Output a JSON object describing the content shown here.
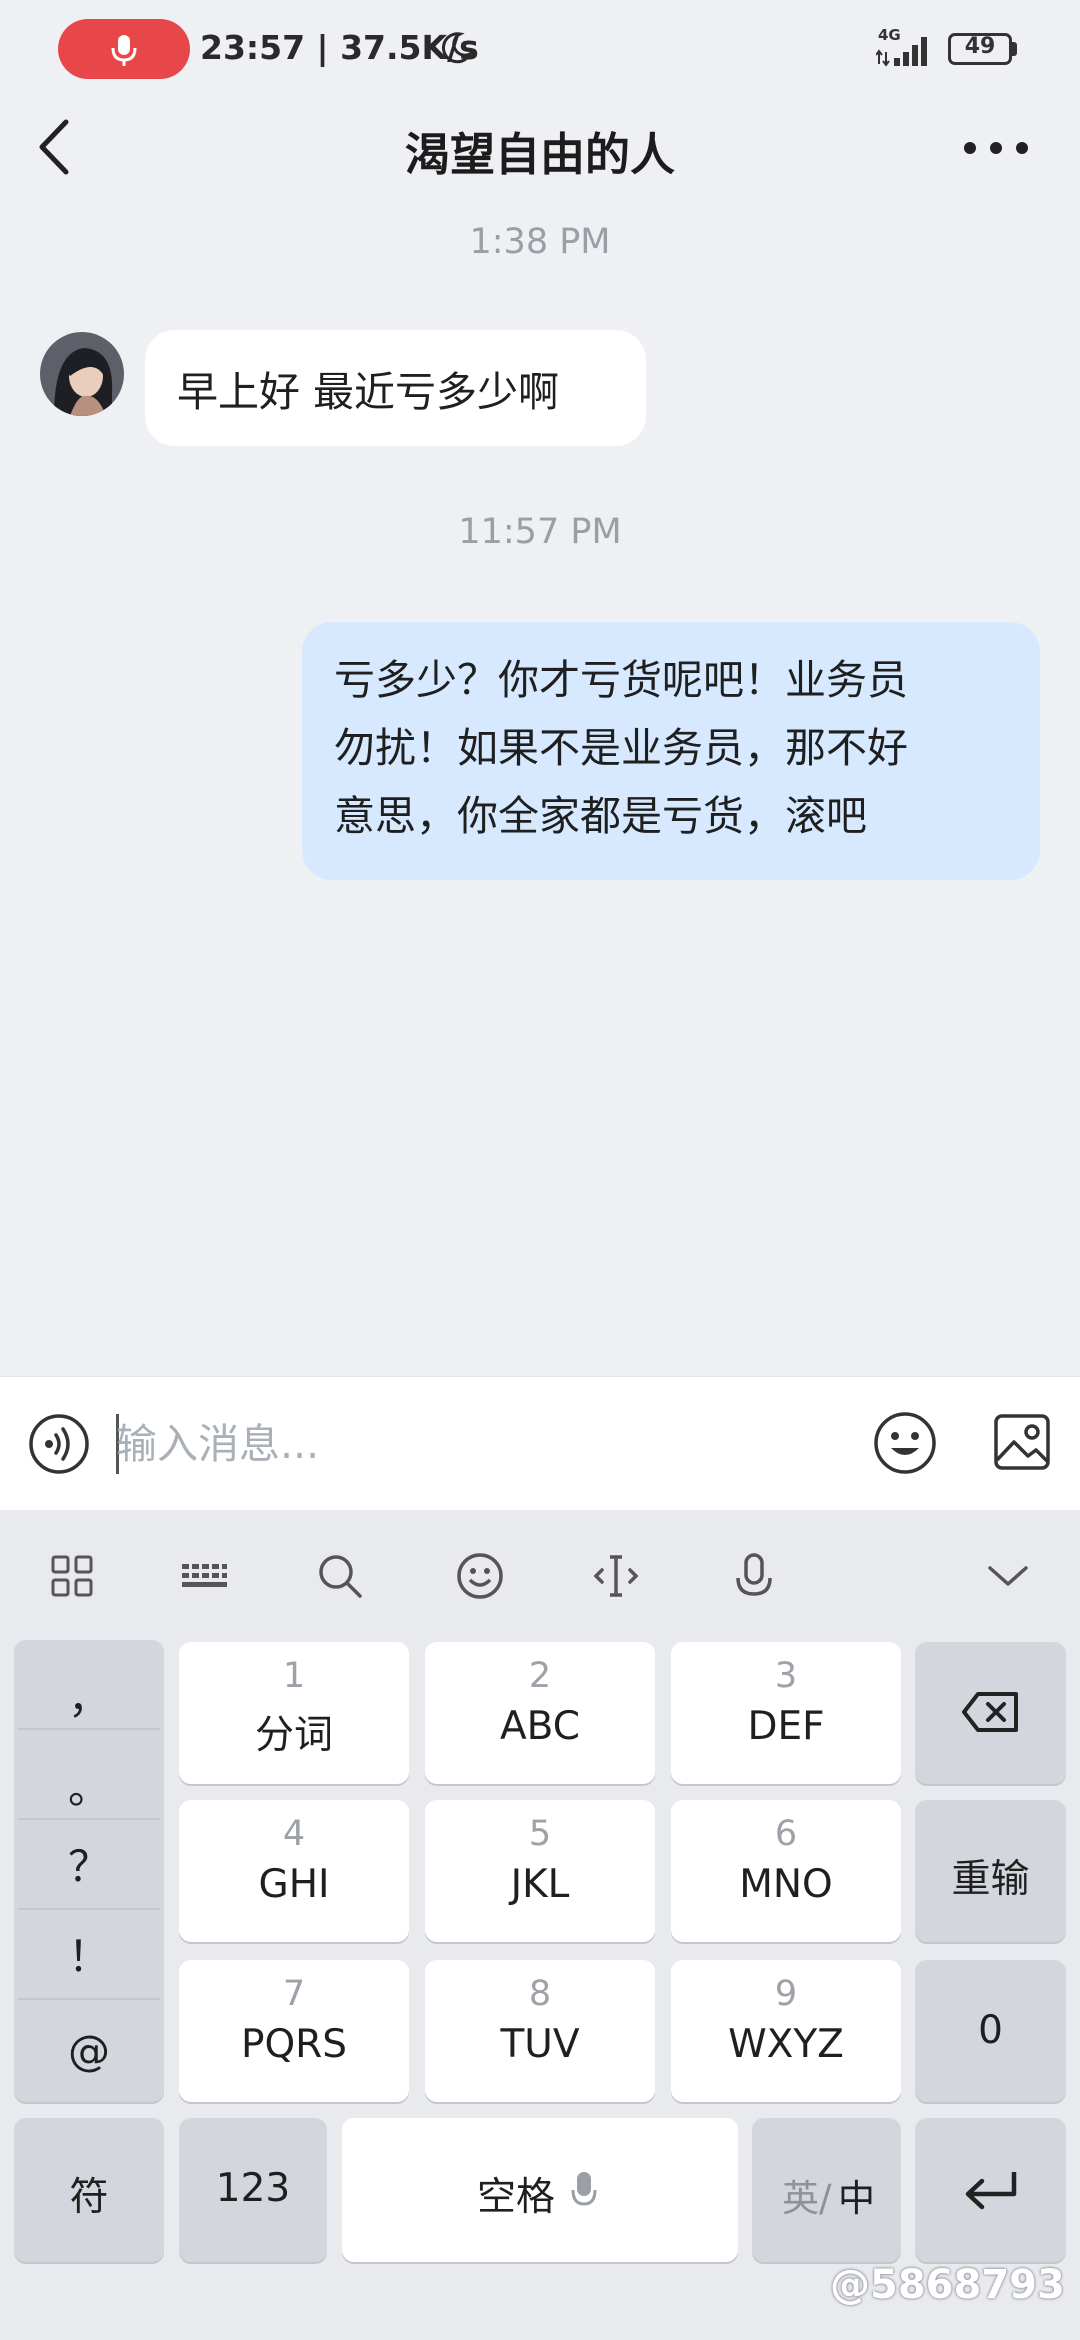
{
  "status_bar": {
    "time_speed": "23:57 | 37.5K/s",
    "network": "4G",
    "battery": "49",
    "icons": [
      "mic-icon",
      "moon-icon",
      "signal-icon",
      "battery-icon"
    ]
  },
  "header": {
    "title": "渴望自由的人",
    "back_icon": "chevron-left-icon",
    "more_icon": "more-dots-icon"
  },
  "messages": [
    {
      "timestamp": "1:38 PM",
      "direction": "incoming",
      "text": "早上好 最近亏多少啊"
    },
    {
      "timestamp": "11:57 PM",
      "direction": "outgoing",
      "lines": [
        "亏多少？你才亏货呢吧！业务员",
        "勿扰！如果不是业务员，那不好",
        "意思，你全家都是亏货，滚吧"
      ]
    }
  ],
  "input": {
    "placeholder": "输入消息...",
    "value": ""
  },
  "keyboard": {
    "toolbar_icons": [
      "grid-icon",
      "keyboard-icon",
      "search-icon",
      "emoji-icon",
      "cursor-icon",
      "mic-icon",
      "chevron-down-icon"
    ],
    "symbols": [
      "，",
      "。",
      "？",
      "！",
      "@"
    ],
    "keys": [
      {
        "num": "1",
        "label": "分词"
      },
      {
        "num": "2",
        "label": "ABC"
      },
      {
        "num": "3",
        "label": "DEF"
      },
      {
        "num": "4",
        "label": "GHI"
      },
      {
        "num": "5",
        "label": "JKL"
      },
      {
        "num": "6",
        "label": "MNO"
      },
      {
        "num": "7",
        "label": "PQRS"
      },
      {
        "num": "8",
        "label": "TUV"
      },
      {
        "num": "9",
        "label": "WXYZ"
      }
    ],
    "reenter_label": "重输",
    "zero_label": "0",
    "fu_label": "符",
    "num_label": "123",
    "space_label": "空格",
    "lang_en": "英/",
    "lang_zh": "中"
  },
  "colors": {
    "background": "#eef0f4",
    "outgoing_bubble": "#d6e9ff",
    "incoming_bubble": "#ffffff",
    "record_pill": "#e8474a"
  },
  "watermark": "@5868793"
}
